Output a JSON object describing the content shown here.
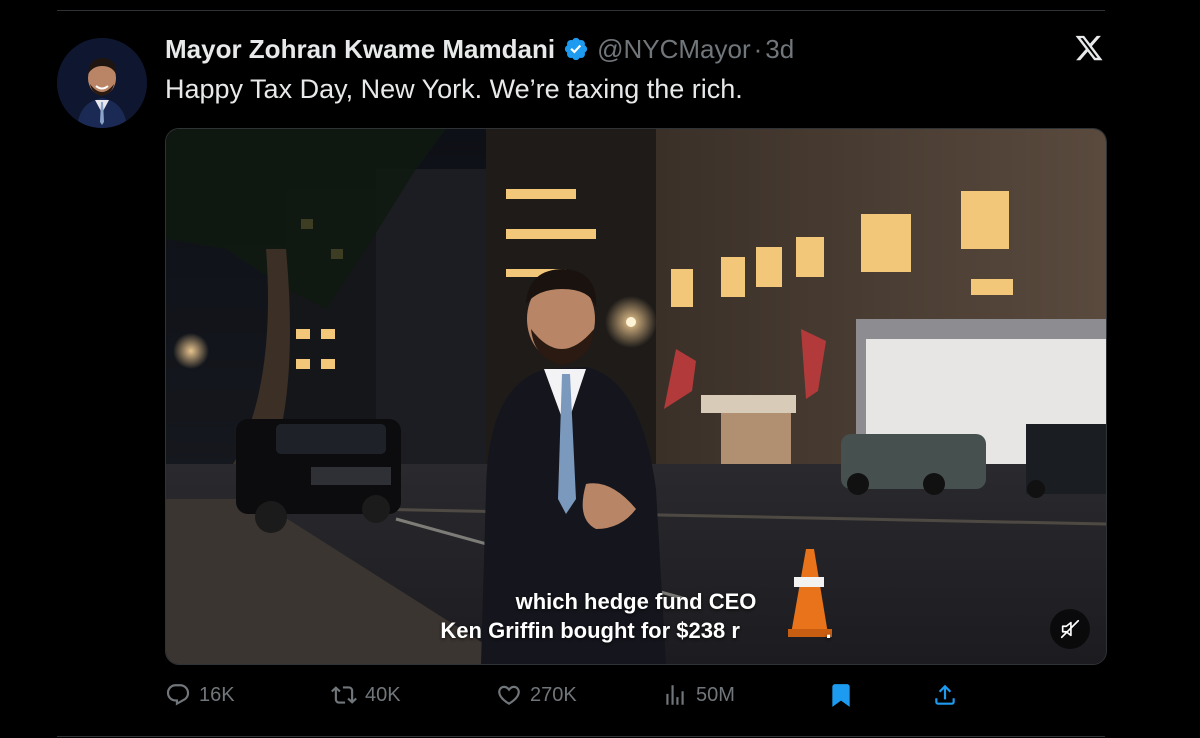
{
  "post": {
    "author_name": "Mayor Zohran Kwame Mamdani",
    "handle": "@NYCMayor",
    "separator": "·",
    "time": "3d",
    "text": "Happy Tax Day, New York. We’re taxing the rich."
  },
  "video": {
    "caption_line1": "which hedge fund CEO",
    "caption_line2": "Ken Griffin bought for $238 r              ."
  },
  "actions": {
    "replies": "16K",
    "reposts": "40K",
    "likes": "270K",
    "views": "50M"
  },
  "colors": {
    "background": "#000000",
    "text": "#e7e9ea",
    "muted": "#71767b",
    "verified": "#1d9bf0",
    "bookmark_active": "#1d9bf0"
  },
  "icons": [
    "verified-badge-icon",
    "x-logo-icon",
    "mute-icon",
    "reply-icon",
    "repost-icon",
    "like-icon",
    "views-icon",
    "bookmark-icon",
    "share-icon"
  ]
}
